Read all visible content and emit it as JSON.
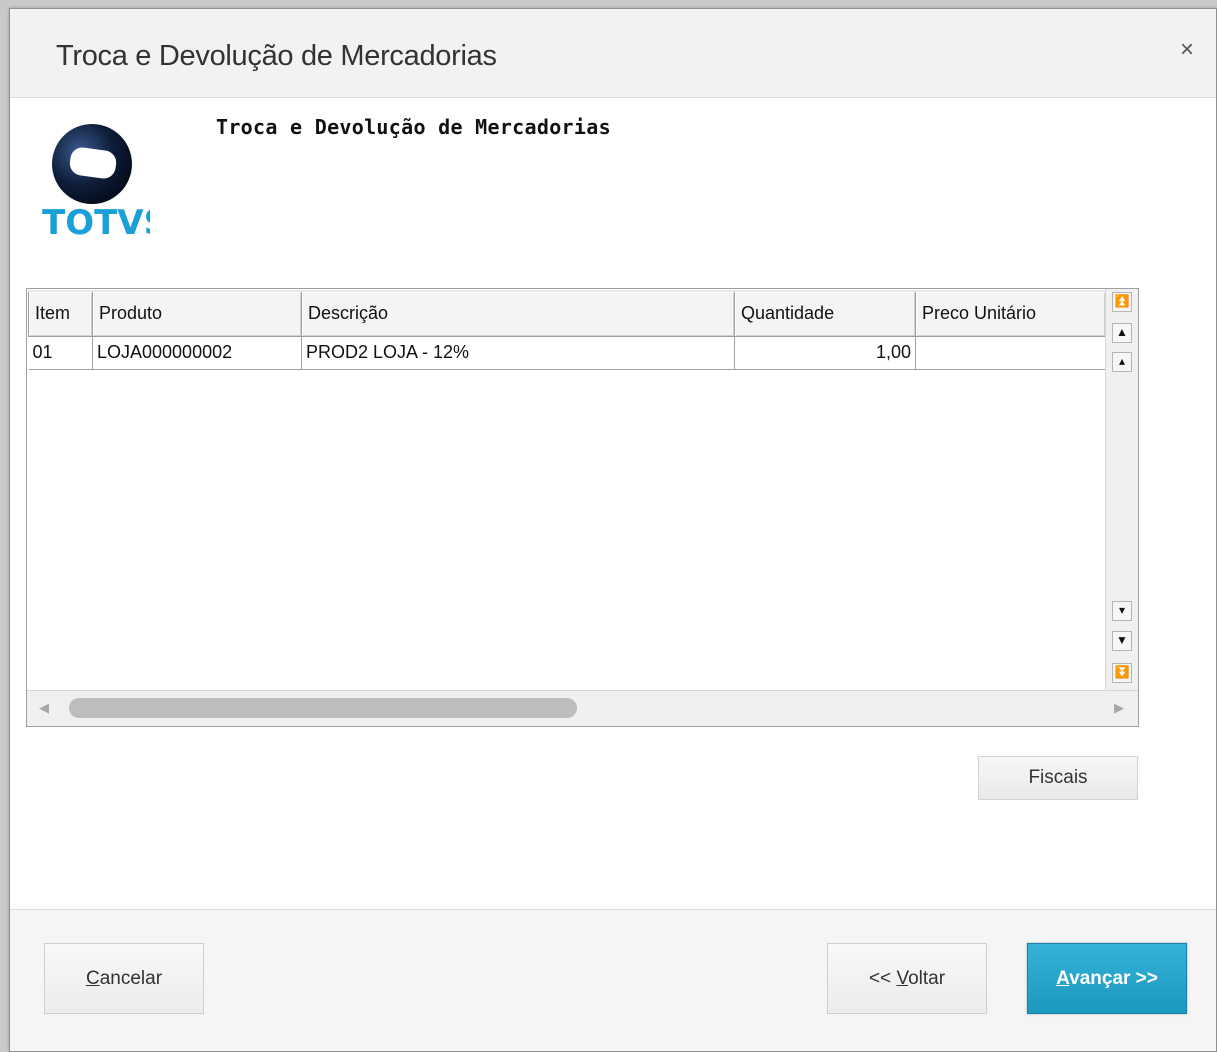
{
  "window": {
    "title": "Troca e Devolução de Mercadorias",
    "close_label": "×"
  },
  "header": {
    "label": "Troca e Devolução de Mercadorias",
    "logo_text": "TOTVS"
  },
  "grid": {
    "columns": [
      "Item",
      "Produto",
      "Descrição",
      "Quantidade",
      "Preco Unitário"
    ],
    "rows": [
      [
        "01",
        "LOJA000000002",
        "PROD2 LOJA - 12%",
        "1,00",
        ""
      ]
    ]
  },
  "buttons": {
    "fiscais": "Fiscais",
    "cancel_hotkey": "C",
    "cancel_rest": "ancelar",
    "back_prefix": "<< ",
    "back_hotkey": "V",
    "back_rest": "oltar",
    "next_hotkey": "A",
    "next_rest": "vançar >>"
  },
  "colors": {
    "primary_button": "#1c98c1",
    "logo_blue": "#1a9fd8",
    "logo_dark": "#0d1d38"
  }
}
